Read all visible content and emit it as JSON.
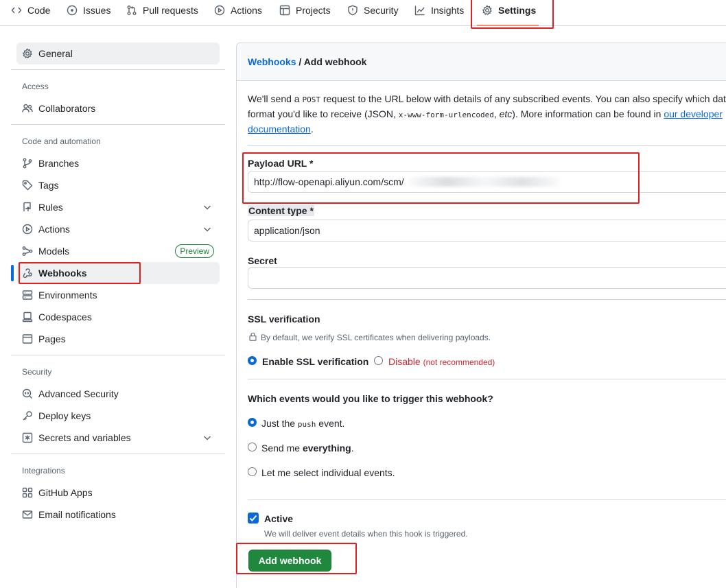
{
  "topnav": {
    "tabs": [
      {
        "label": "Code",
        "icon": "code-icon"
      },
      {
        "label": "Issues",
        "icon": "issue-opened-icon"
      },
      {
        "label": "Pull requests",
        "icon": "git-pull-request-icon"
      },
      {
        "label": "Actions",
        "icon": "play-icon"
      },
      {
        "label": "Projects",
        "icon": "table-icon"
      },
      {
        "label": "Security",
        "icon": "shield-icon"
      },
      {
        "label": "Insights",
        "icon": "graph-icon"
      },
      {
        "label": "Settings",
        "icon": "gear-icon"
      }
    ],
    "active_tab": "Settings"
  },
  "sidebar": {
    "general": "General",
    "sections": [
      {
        "heading": "Access",
        "items": [
          "Collaborators"
        ]
      },
      {
        "heading": "Code and automation",
        "items": [
          "Branches",
          "Tags",
          "Rules",
          "Actions",
          "Models",
          "Webhooks",
          "Environments",
          "Codespaces",
          "Pages"
        ]
      },
      {
        "heading": "Security",
        "items": [
          "Advanced Security",
          "Deploy keys",
          "Secrets and variables"
        ]
      },
      {
        "heading": "Integrations",
        "items": [
          "GitHub Apps",
          "Email notifications"
        ]
      }
    ],
    "models_badge": "Preview",
    "selected": "Webhooks"
  },
  "main": {
    "breadcrumb_parent": "Webhooks",
    "breadcrumb_sep": " / ",
    "breadcrumb_current": "Add webhook",
    "intro_1": "We'll send a ",
    "intro_code_1": "POST",
    "intro_2": " request to the URL below with details of any subscribed events. You can also specify which data format you'd like to receive (JSON, ",
    "intro_code_2": "x-www-form-urlencoded",
    "intro_3": ", ",
    "intro_etc": "etc",
    "intro_4": "). More information can be found in ",
    "intro_link": "our developer documentation",
    "intro_5": ".",
    "payload_label": "Payload URL *",
    "payload_value": "http://flow-openapi.aliyun.com/scm/",
    "content_type_label": "Content type *",
    "content_type_value": "application/json",
    "secret_label": "Secret",
    "secret_value": "",
    "ssl_heading": "SSL verification",
    "ssl_note": "By default, we verify SSL certificates when delivering payloads.",
    "ssl_enable": "Enable SSL verification",
    "ssl_disable": "Disable",
    "ssl_disable_note": "(not recommended)",
    "events_heading": "Which events would you like to trigger this webhook?",
    "event_push_pre": "Just the ",
    "event_push_code": "push",
    "event_push_post": " event.",
    "event_all_pre": "Send me ",
    "event_all_bold": "everything",
    "event_all_post": ".",
    "event_select": "Let me select individual events.",
    "active_label": "Active",
    "active_note": "We will deliver event details when this hook is triggered.",
    "submit": "Add webhook"
  },
  "colors": {
    "accent": "#0969da",
    "primary_button": "#1f883d",
    "danger": "#d1242f",
    "annotation": "#e02020"
  }
}
